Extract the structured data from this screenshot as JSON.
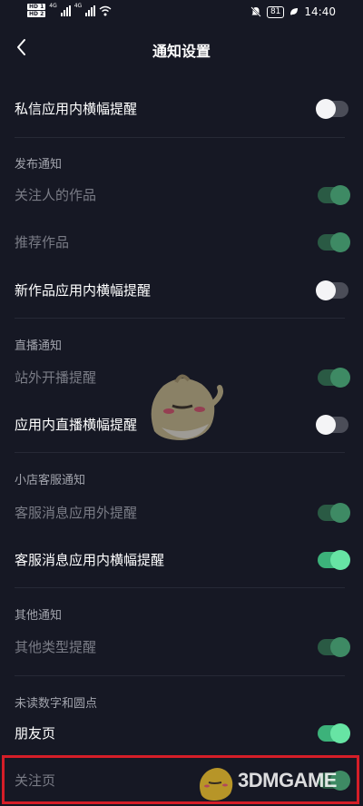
{
  "status_bar": {
    "hd1": "HD 1",
    "hd2": "HD 2",
    "net1": "4G",
    "net2": "4G",
    "battery": "81",
    "time": "14:40"
  },
  "header": {
    "title": "通知设置"
  },
  "rows": [
    {
      "label": "私信应用内横幅提醒",
      "on": false,
      "disabled": false
    },
    {
      "label": "关注人的作品",
      "on": true,
      "disabled": true
    },
    {
      "label": "推荐作品",
      "on": true,
      "disabled": true
    },
    {
      "label": "新作品应用内横幅提醒",
      "on": false,
      "disabled": false
    },
    {
      "label": "站外开播提醒",
      "on": true,
      "disabled": true
    },
    {
      "label": "应用内直播横幅提醒",
      "on": false,
      "disabled": false
    },
    {
      "label": "客服消息应用外提醒",
      "on": true,
      "disabled": true
    },
    {
      "label": "客服消息应用内横幅提醒",
      "on": true,
      "disabled": false
    },
    {
      "label": "其他类型提醒",
      "on": true,
      "disabled": true
    },
    {
      "label": "朋友页",
      "on": true,
      "disabled": false
    },
    {
      "label": "关注页",
      "on": true,
      "disabled": true
    }
  ],
  "sections": {
    "publish": "发布通知",
    "live": "直播通知",
    "shop": "小店客服通知",
    "other": "其他通知",
    "unread": "未读数字和圆点"
  },
  "watermark": {
    "text": "3DMGAME"
  },
  "colors": {
    "background": "#161824",
    "toggle_on": "#3cb27a",
    "toggle_off": "#4b4d58",
    "highlight": "#d51e28"
  }
}
